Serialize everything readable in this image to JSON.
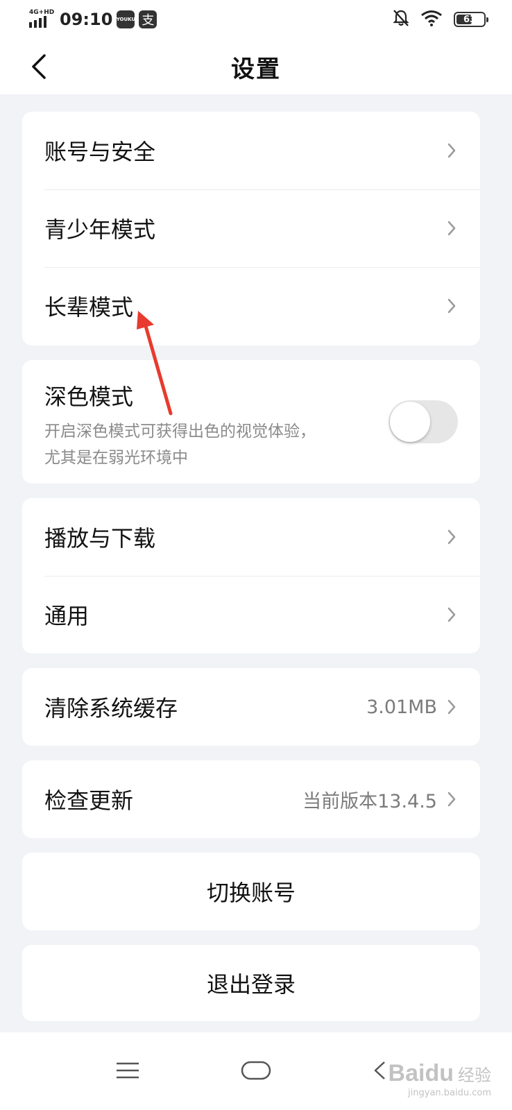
{
  "status_bar": {
    "network": "4G+HD",
    "time": "09:10",
    "app_badge": "YOUKU",
    "zhi_badge": "支",
    "battery": "63",
    "battery_fraction": 0.63
  },
  "header": {
    "title": "设置"
  },
  "group1": [
    {
      "label": "账号与安全"
    },
    {
      "label": "青少年模式"
    },
    {
      "label": "长辈模式"
    }
  ],
  "dark_mode": {
    "title": "深色模式",
    "description_line1": "开启深色模式可获得出色的视觉体验，",
    "description_line2": "尤其是在弱光环境中",
    "enabled": false
  },
  "group3": [
    {
      "label": "播放与下载"
    },
    {
      "label": "通用"
    }
  ],
  "cache": {
    "label": "清除系统缓存",
    "value": "3.01MB"
  },
  "update": {
    "label": "检查更新",
    "value": "当前版本13.4.5"
  },
  "switch_account": {
    "label": "切换账号"
  },
  "logout": {
    "label": "退出登录"
  },
  "watermark": {
    "logo": "Baidu",
    "cn": "经验",
    "url": "jingyan.baidu.com"
  },
  "colors": {
    "background": "#f1f3f7",
    "card": "#ffffff",
    "arrow": "#e83a2e",
    "toggle_off": "#e6e6e6"
  }
}
